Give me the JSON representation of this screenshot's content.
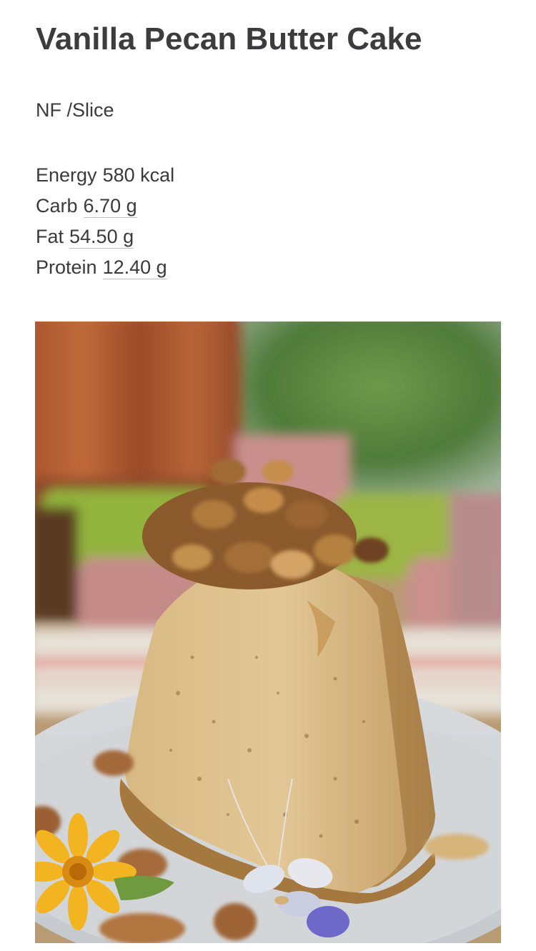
{
  "title": "Vanilla Pecan Butter Cake",
  "serving": "NF /Slice",
  "nutrition": [
    {
      "label": "Energy",
      "value": "580 kcal"
    },
    {
      "label": "Carb",
      "value": "6.70 g"
    },
    {
      "label": "Fat",
      "value": "54.50 g"
    },
    {
      "label": "Protein",
      "value": "12.40 g"
    }
  ],
  "photo": {
    "subject": "slice of vanilla pecan butter cake topped with chopped pecans on a white plate"
  }
}
